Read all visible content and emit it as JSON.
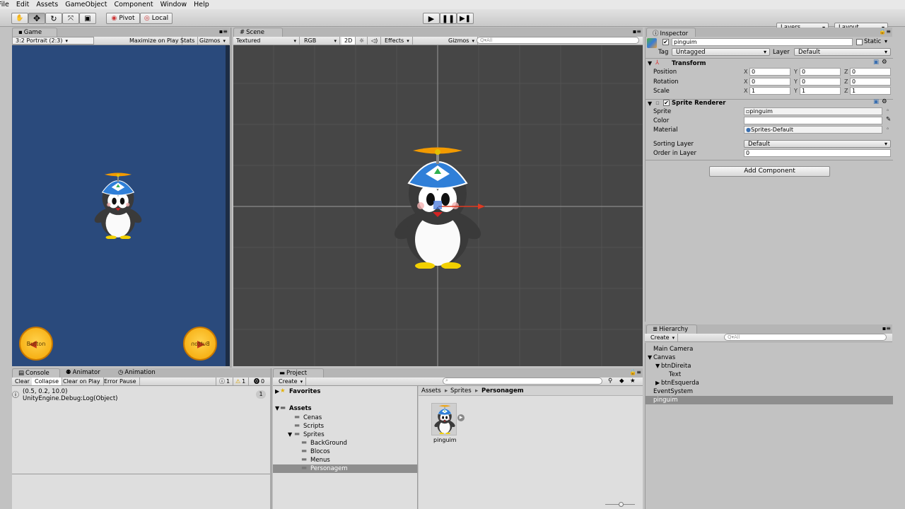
{
  "menu": [
    "File",
    "Edit",
    "Assets",
    "GameObject",
    "Component",
    "Window",
    "Help"
  ],
  "toolbar": {
    "pivot": "Pivot",
    "local": "Local",
    "layers": "Layers",
    "layout": "Layout"
  },
  "game": {
    "tab": "Game",
    "aspect": "3:2 Portrait (2:3)",
    "maximize": "Maximize on Play",
    "stats": "Stats",
    "gizmos": "Gizmos",
    "button_left": "Button",
    "button_right": "Button",
    "bg_color": "#2a4a7c"
  },
  "scene": {
    "tab": "Scene",
    "shading": "Textured",
    "rgb": "RGB",
    "mode2d": "2D",
    "effects": "Effects",
    "gizmos": "Gizmos",
    "search": "Q▾All",
    "bg_color": "#464646"
  },
  "inspector": {
    "tab": "Inspector",
    "object_name": "pinguim",
    "static": "Static",
    "tag_label": "Tag",
    "tag_value": "Untagged",
    "layer_label": "Layer",
    "layer_value": "Default",
    "transform": {
      "title": "Transform",
      "rows": [
        {
          "label": "Position",
          "x": "0",
          "y": "0",
          "z": "0"
        },
        {
          "label": "Rotation",
          "x": "0",
          "y": "0",
          "z": "0"
        },
        {
          "label": "Scale",
          "x": "1",
          "y": "1",
          "z": "1"
        }
      ]
    },
    "sprite_renderer": {
      "title": "Sprite Renderer",
      "sprite_label": "Sprite",
      "sprite_value": "pinguim",
      "color_label": "Color",
      "material_label": "Material",
      "material_value": "Sprites-Default",
      "sorting_label": "Sorting Layer",
      "sorting_value": "Default",
      "order_label": "Order in Layer",
      "order_value": "0"
    },
    "add_component": "Add Component"
  },
  "hierarchy": {
    "tab": "Hierarchy",
    "create": "Create",
    "search": "Q▾All",
    "items": [
      {
        "label": "Main Camera",
        "indent": 0
      },
      {
        "label": "Canvas",
        "indent": 0,
        "fold": "▼"
      },
      {
        "label": "btnDireita",
        "indent": 1,
        "fold": "▼"
      },
      {
        "label": "Text",
        "indent": 2
      },
      {
        "label": "btnEsquerda",
        "indent": 1,
        "fold": "▶"
      },
      {
        "label": "EventSystem",
        "indent": 0
      },
      {
        "label": "pinguim",
        "indent": 0,
        "selected": true
      }
    ]
  },
  "console": {
    "tabs": [
      "Console",
      "Animator",
      "Animation"
    ],
    "clear": "Clear",
    "collapse": "Collapse",
    "clear_on_play": "Clear on Play",
    "error_pause": "Error Pause",
    "count_info": "1",
    "count_warn": "1",
    "count_err": "0",
    "log_line1": "(0.5, 0.2, 10.0)",
    "log_line2": "UnityEngine.Debug:Log(Object)",
    "log_count": "1"
  },
  "project": {
    "tab": "Project",
    "create": "Create",
    "favorites": "Favorites",
    "assets": "Assets",
    "folders": [
      {
        "label": "Cenas",
        "indent": 1
      },
      {
        "label": "Scripts",
        "indent": 1
      },
      {
        "label": "Sprites",
        "indent": 1,
        "fold": "▼"
      },
      {
        "label": "BackGround",
        "indent": 2
      },
      {
        "label": "Blocos",
        "indent": 2
      },
      {
        "label": "Menus",
        "indent": 2
      },
      {
        "label": "Personagem",
        "indent": 2,
        "selected": true
      }
    ],
    "breadcrumb": [
      "Assets",
      "Sprites",
      "Personagem"
    ],
    "asset_name": "pinguim"
  }
}
